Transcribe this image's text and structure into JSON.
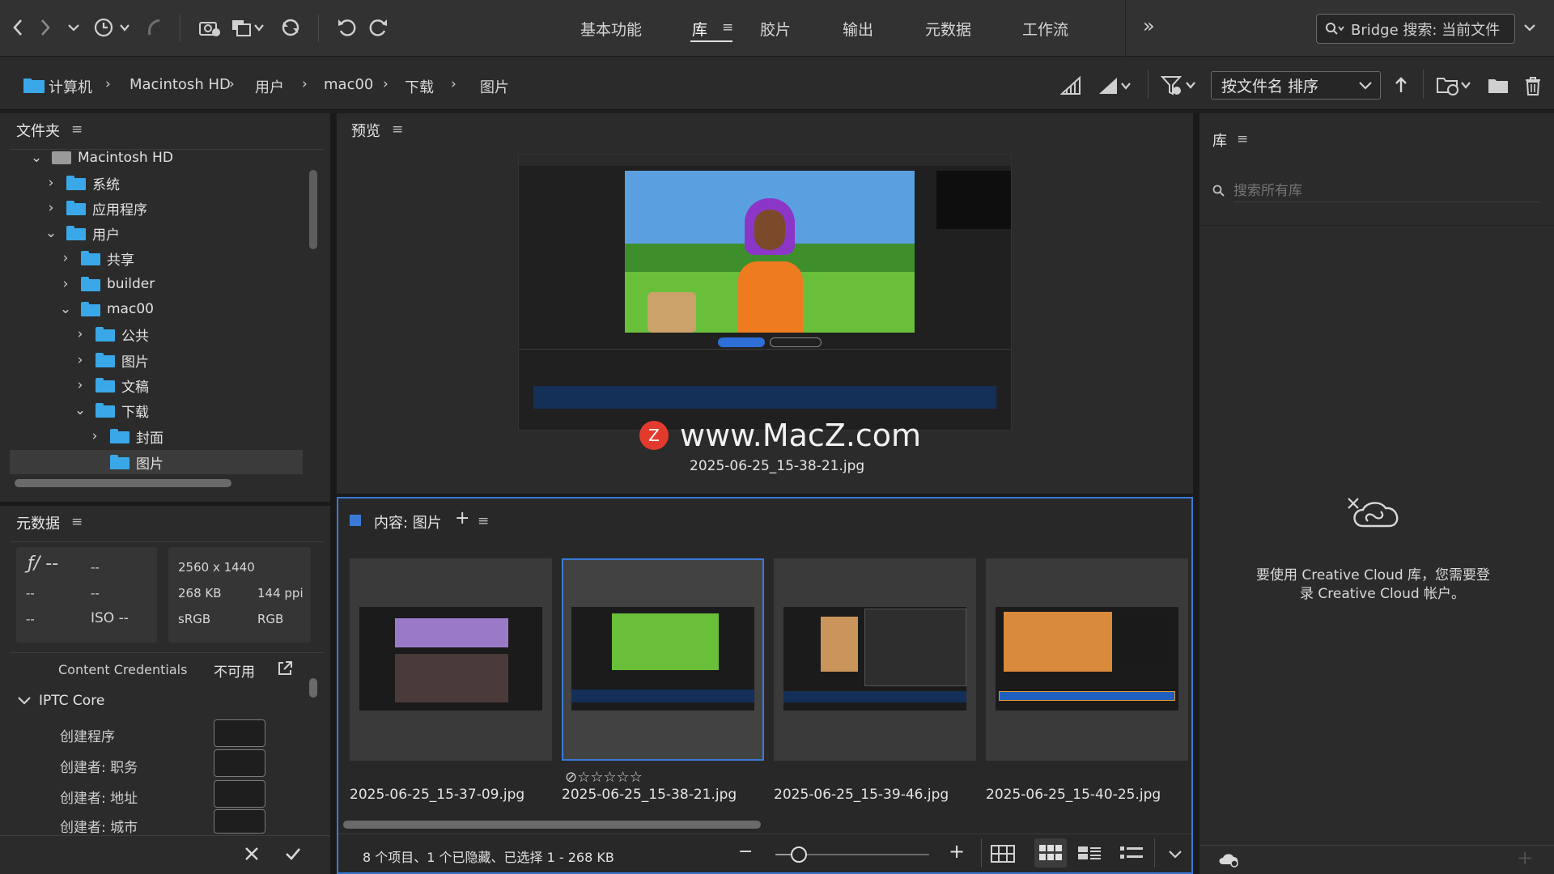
{
  "toolbar": {
    "workspaces": [
      "基本功能",
      "库",
      "胶片",
      "输出",
      "元数据",
      "工作流"
    ],
    "active_workspace": "库",
    "more_label": "»",
    "search_placeholder": "Bridge 搜索: 当前文件"
  },
  "path": {
    "crumbs": [
      "计算机",
      "Macintosh HD",
      "用户",
      "mac00",
      "下载",
      "图片"
    ],
    "sort_label": "按文件名 排序"
  },
  "folders": {
    "title": "文件夹",
    "tree": [
      {
        "label": "Macintosh HD",
        "expanded": true
      },
      {
        "label": "系统",
        "expanded": false
      },
      {
        "label": "应用程序",
        "expanded": false
      },
      {
        "label": "用户",
        "expanded": true
      },
      {
        "label": "共享",
        "expanded": false
      },
      {
        "label": "builder",
        "expanded": false
      },
      {
        "label": "mac00",
        "expanded": true
      },
      {
        "label": "公共",
        "expanded": false
      },
      {
        "label": "图片",
        "expanded": false
      },
      {
        "label": "文稿",
        "expanded": false
      },
      {
        "label": "下载",
        "expanded": true
      },
      {
        "label": "封面",
        "expanded": false
      },
      {
        "label": "图片",
        "selected": true
      }
    ]
  },
  "metadata": {
    "title": "元数据",
    "aperture": "ƒ/ --",
    "shutter": "--",
    "c1": "--",
    "c2": "--",
    "c3": "--",
    "iso": "ISO --",
    "dimensions": "2560 x 1440",
    "filesize": "268 KB",
    "ppi": "144 ppi",
    "colorprofile": "sRGB",
    "colormode": "RGB",
    "content_credentials_label": "Content Credentials",
    "content_credentials_value": "不可用",
    "iptc_title": "IPTC Core",
    "iptc_fields": [
      "创建程序",
      "创建者: 职务",
      "创建者: 地址",
      "创建者: 城市"
    ]
  },
  "preview": {
    "title": "预览",
    "watermark": "www.MacZ.com",
    "filename": "2025-06-25_15-38-21.jpg"
  },
  "content": {
    "title": "内容: 图片",
    "items": [
      {
        "name": "2025-06-25_15-37-09.jpg",
        "selected": false
      },
      {
        "name": "2025-06-25_15-38-21.jpg",
        "selected": true
      },
      {
        "name": "2025-06-25_15-39-46.jpg",
        "selected": false
      },
      {
        "name": "2025-06-25_15-40-25.jpg",
        "selected": false
      }
    ],
    "status": "8 个项目、1 个已隐藏、已选择 1 - 268 KB",
    "thumbnail_zoom": 0.15
  },
  "library": {
    "title": "库",
    "search_placeholder": "搜索所有库",
    "message_line1": "要使用 Creative Cloud 库，您需要登",
    "message_line2": "录 Creative Cloud 帐户。"
  },
  "colors": {
    "accent": "#3b7ad6",
    "folder": "#3aa8e8"
  }
}
